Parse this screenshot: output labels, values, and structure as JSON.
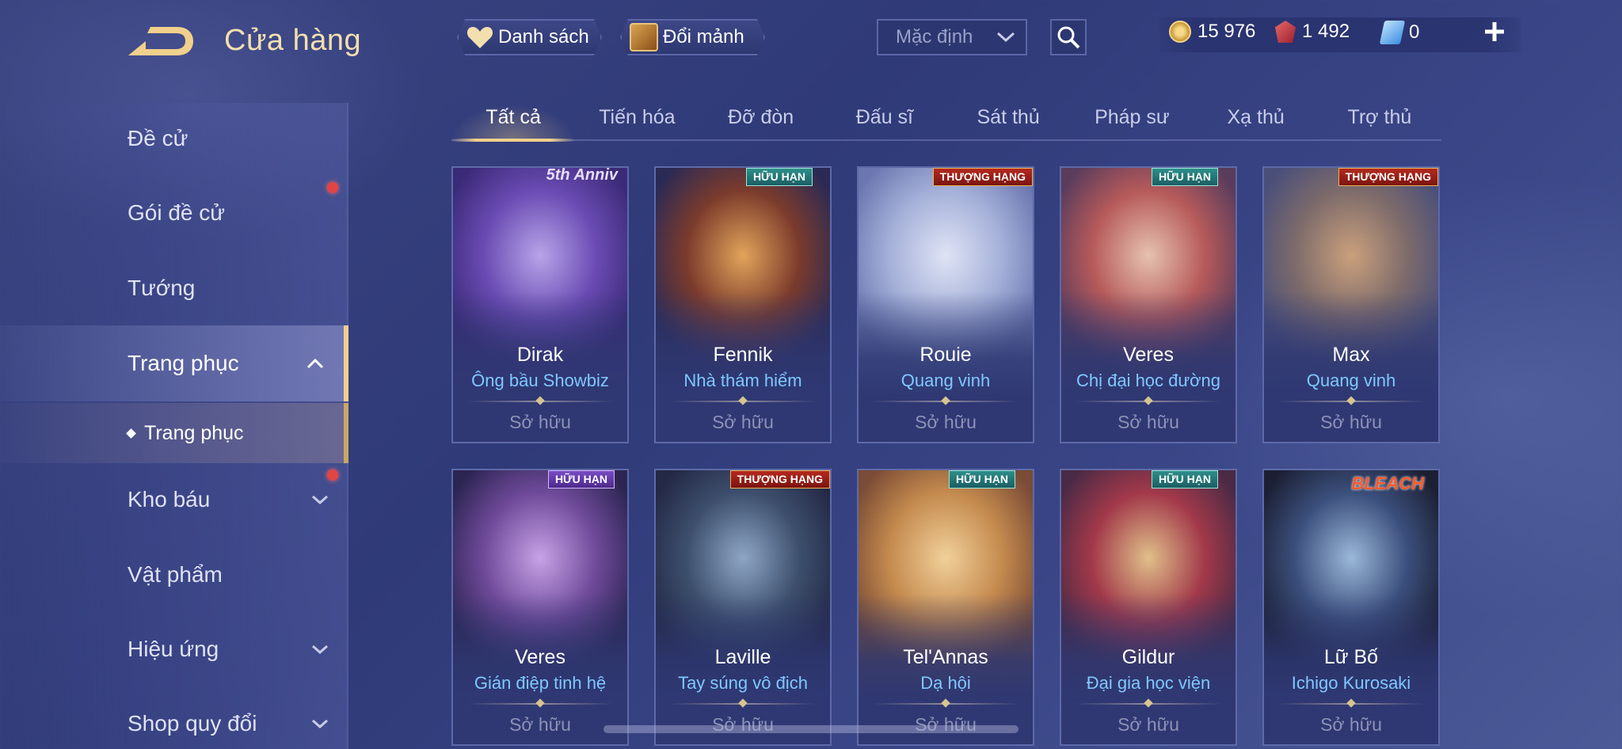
{
  "header": {
    "title": "Cửa hàng",
    "wishlist_label": "Danh sách",
    "shards_label": "Đổi mảnh",
    "sort_value": "Mặc định"
  },
  "currencies": {
    "gold": "15 976",
    "ruby": "1 492",
    "voucher": "0"
  },
  "sidebar": {
    "items": [
      {
        "label": "Đề cử"
      },
      {
        "label": "Gói đề cử"
      },
      {
        "label": "Tướng"
      },
      {
        "label": "Trang phục"
      },
      {
        "label": "Kho báu"
      },
      {
        "label": "Vật phẩm"
      },
      {
        "label": "Hiệu ứng"
      },
      {
        "label": "Shop quy đổi"
      }
    ],
    "sub_item": "Trang phục"
  },
  "tabs": [
    "Tất cả",
    "Tiến hóa",
    "Đỡ đòn",
    "Đấu sĩ",
    "Sát thủ",
    "Pháp sư",
    "Xạ thủ",
    "Trợ thủ"
  ],
  "cards": [
    {
      "hero": "Dirak",
      "skin": "Ông bầu Showbiz",
      "status": "Sở hữu",
      "badge": "5th Anniv",
      "badge_type": "anniv",
      "colors": [
        "#b7a4e8",
        "#6a4bb3",
        "#3b2a77"
      ]
    },
    {
      "hero": "Fennik",
      "skin": "Nhà thám hiểm",
      "status": "Sở hữu",
      "badge": "HỮU HẠN",
      "badge_type": "limited",
      "colors": [
        "#e2a45a",
        "#7b3b2c",
        "#2b2a55"
      ]
    },
    {
      "hero": "Rouie",
      "skin": "Quang vinh",
      "status": "Sở hữu",
      "badge": "THƯỢNG HẠNG",
      "badge_type": "ranked",
      "colors": [
        "#dfe3f5",
        "#a4b0d8",
        "#6b77b0"
      ]
    },
    {
      "hero": "Veres",
      "skin": "Chị đại học đường",
      "status": "Sở hữu",
      "badge": "HỮU HẠN",
      "badge_type": "limited",
      "colors": [
        "#e6c2b0",
        "#b65a5a",
        "#5a3c5c"
      ]
    },
    {
      "hero": "Max",
      "skin": "Quang vinh",
      "status": "Sở hữu",
      "badge": "THƯỢNG HẠNG",
      "badge_type": "ranked",
      "colors": [
        "#caa07c",
        "#7d6b6b",
        "#4a4f7a"
      ]
    },
    {
      "hero": "Veres",
      "skin": "Gián điệp tinh hệ",
      "status": "Sở hữu",
      "badge": "HỮU HẠN",
      "badge_type": "limited-purple",
      "colors": [
        "#c7a2e6",
        "#6f4a9a",
        "#2c2552"
      ]
    },
    {
      "hero": "Laville",
      "skin": "Tay súng vô địch",
      "status": "Sở hữu",
      "badge": "THƯỢNG HẠNG",
      "badge_type": "ranked",
      "colors": [
        "#8da6c4",
        "#3d4f6d",
        "#232845"
      ]
    },
    {
      "hero": "Tel'Annas",
      "skin": "Dạ hội",
      "status": "Sở hữu",
      "badge": "HỮU HẠN",
      "badge_type": "limited",
      "colors": [
        "#f1d09a",
        "#c48a4e",
        "#7a4b35"
      ]
    },
    {
      "hero": "Gildur",
      "skin": "Đại gia học viện",
      "status": "Sở hữu",
      "badge": "HỮU HẠN",
      "badge_type": "limited",
      "colors": [
        "#e0c08a",
        "#a2394a",
        "#4a2a45"
      ]
    },
    {
      "hero": "Lữ Bố",
      "skin": "Ichigo Kurosaki",
      "status": "Sở hữu",
      "badge": "BLEACH",
      "badge_type": "bleach",
      "colors": [
        "#9ab7d8",
        "#3b4f7c",
        "#1c1f33"
      ]
    }
  ],
  "theme": {
    "accent_gold": "#f0d08c",
    "skin_text_blue": "#7fc8ff",
    "owned_text_gray": "#8d92b6"
  },
  "icons": {
    "back": "back-arrow-icon",
    "wishlist": "heart-icon",
    "shards": "chest-icon",
    "sort": "chevron-down-icon",
    "search": "search-icon",
    "gold": "gold-coin-icon",
    "ruby": "ruby-gem-icon",
    "voucher": "voucher-icon",
    "add": "plus-icon"
  }
}
